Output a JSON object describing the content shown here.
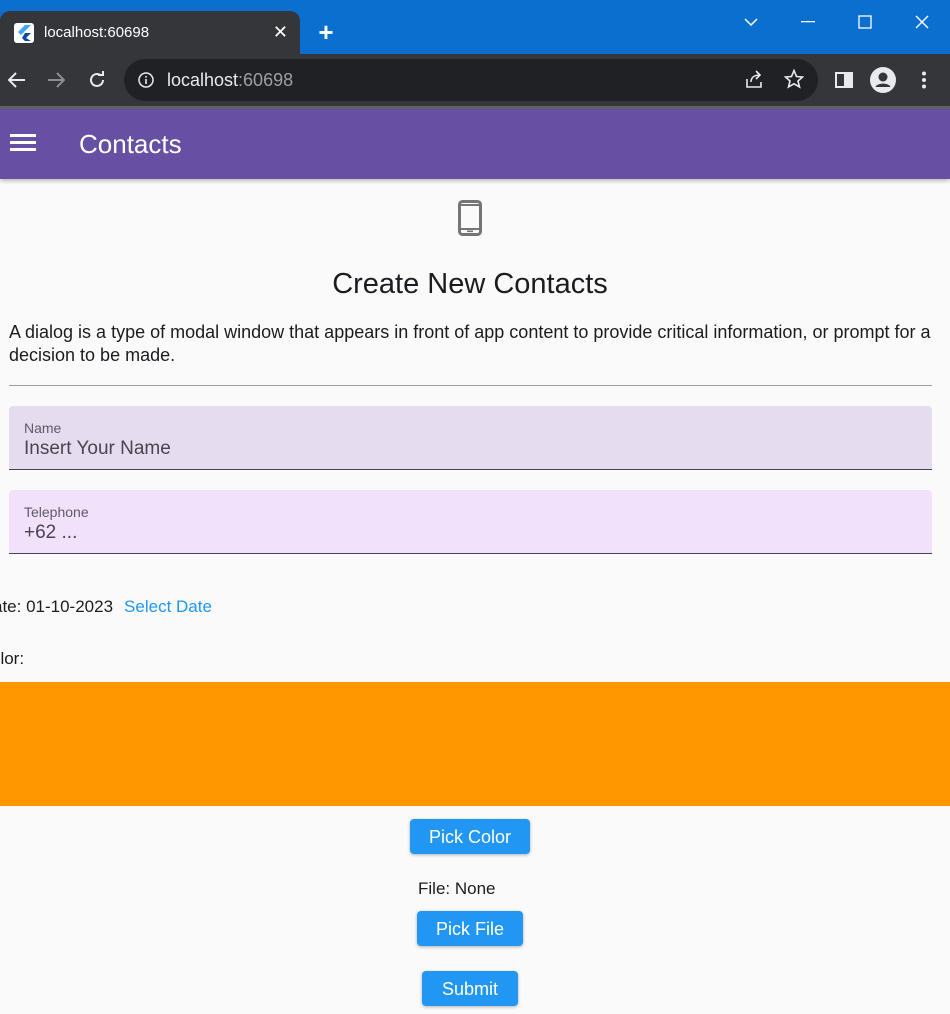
{
  "browser": {
    "tab_title": "localhost:60698",
    "url_host": "localhost",
    "url_port": ":60698"
  },
  "appbar": {
    "title": "Contacts"
  },
  "page": {
    "title": "Create New Contacts",
    "description": "A dialog is a type of modal window that appears in front of app content to provide critical information, or prompt for a decision to be made."
  },
  "form": {
    "name_label": "Name",
    "name_placeholder": "Insert Your Name",
    "name_value": "",
    "tel_label": "Telephone",
    "tel_placeholder": "+62 ...",
    "tel_value": "",
    "date_text": "ate: 01-10-2023",
    "select_date_label": "Select Date",
    "color_text": "olor:",
    "selected_color": "#ff9800",
    "pick_color_label": "Pick Color",
    "file_text": "File: None",
    "pick_file_label": "Pick File",
    "submit_label": "Submit"
  },
  "colors": {
    "appbar": "#6750a4",
    "accent_button": "#2196f3",
    "name_field_bg": "#e6dcef",
    "tel_field_bg": "#f1e1fa"
  }
}
